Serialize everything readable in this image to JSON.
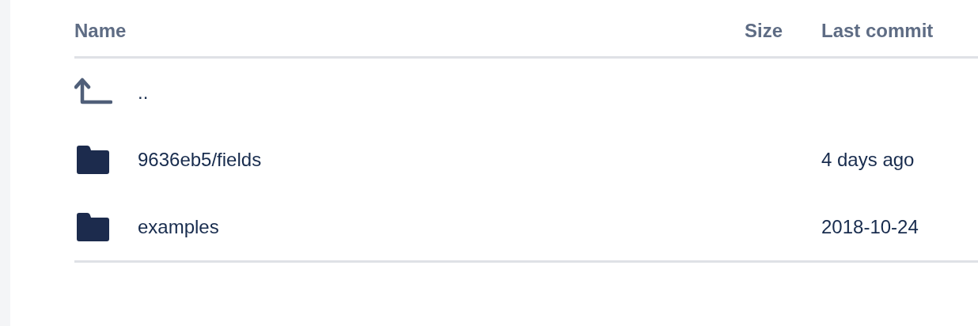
{
  "table": {
    "columns": [
      {
        "label": "Name"
      },
      {
        "label": "Size"
      },
      {
        "label": "Last commit"
      }
    ],
    "rows": [
      {
        "kind": "parent",
        "name": ".."
      },
      {
        "kind": "folder",
        "name": "9636eb5/fields",
        "last_commit": "4 days ago"
      },
      {
        "kind": "folder",
        "name": "examples",
        "last_commit": "2018-10-24"
      }
    ]
  }
}
